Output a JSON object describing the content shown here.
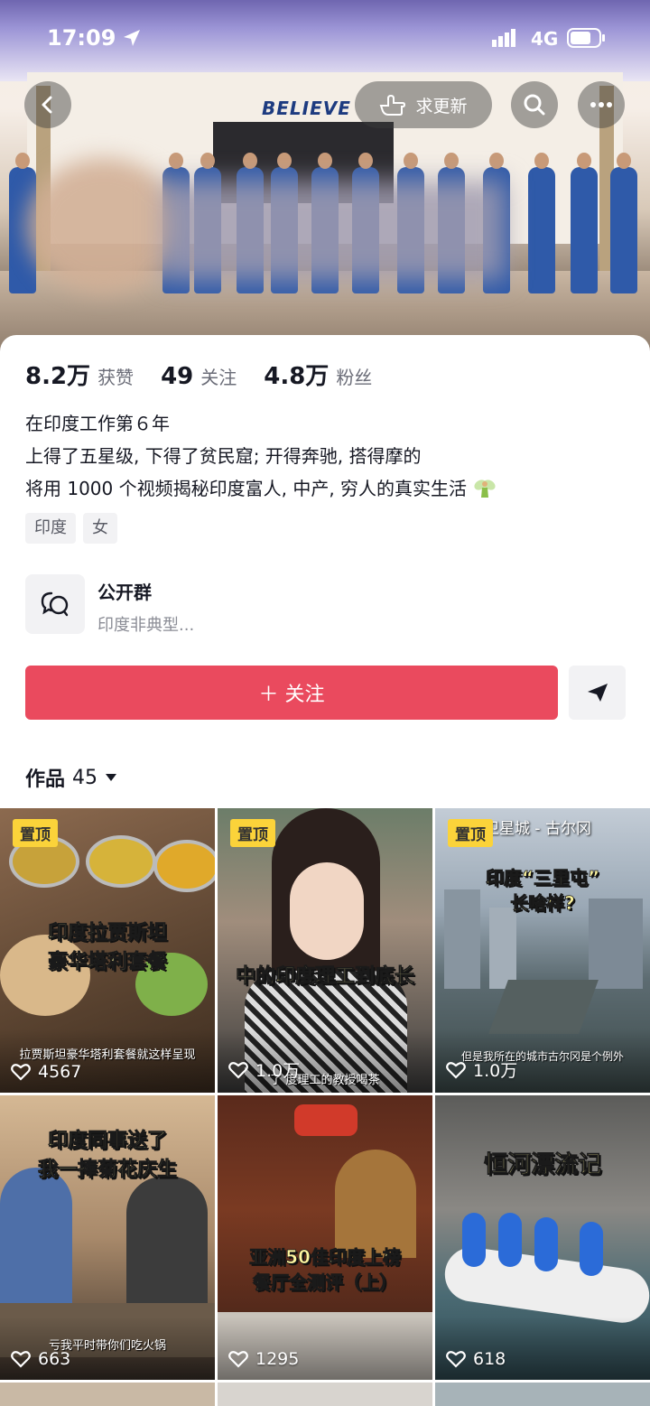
{
  "status_bar": {
    "time": "17:09",
    "network": "4G"
  },
  "banner": {
    "wall_text": "BELIEVE",
    "update_label": "求更新"
  },
  "stats": [
    {
      "num": "8.2万",
      "label": "获赞"
    },
    {
      "num": "49",
      "label": "关注"
    },
    {
      "num": "4.8万",
      "label": "粉丝"
    }
  ],
  "bio": [
    "在印度工作第６年",
    "上得了五星级, 下得了贫民窟; 开得奔驰, 搭得摩的",
    "将用 1000 个视频揭秘印度富人, 中产, 穷人的真实生活"
  ],
  "tags": [
    "印度",
    "女"
  ],
  "group": {
    "title": "公开群",
    "subtitle": "印度非典型..."
  },
  "follow_label": "＋ 关注",
  "works": {
    "label": "作品",
    "count": "45"
  },
  "videos": [
    {
      "pinned": "置顶",
      "caption": [
        "印度拉贾斯坦",
        "豪华塔利套餐"
      ],
      "sub": "拉贾斯坦豪华塔利套餐就这样呈现",
      "likes": "4567",
      "top_text": ""
    },
    {
      "pinned": "置顶",
      "caption": [
        "中的印度理工到底长"
      ],
      "sub": "了   度理工的教授喝茶",
      "likes": "1.0万",
      "top_text": ""
    },
    {
      "pinned": "置顶",
      "caption": [
        "印度“三里屯”",
        "长啥样?"
      ],
      "sub": "但是我所在的城市古尔冈是个例外",
      "likes": "1.0万",
      "top_text": "德里卫星城 - 古尔冈"
    },
    {
      "pinned": "",
      "caption": [
        "印度同事送了",
        "我一捧菊花庆生"
      ],
      "sub": "亏我平时带你们吃火锅",
      "likes": "663",
      "top_text": ""
    },
    {
      "pinned": "",
      "caption": [
        "亚洲50佳印度上榜",
        "餐厅全测评（上）"
      ],
      "sub": "",
      "likes": "1295",
      "top_text": ""
    },
    {
      "pinned": "",
      "caption": [
        "恒河漂流记"
      ],
      "sub": "",
      "likes": "618",
      "top_text": ""
    }
  ],
  "colors": {
    "accent": "#ea4a5e",
    "pin": "#fbd33a"
  }
}
